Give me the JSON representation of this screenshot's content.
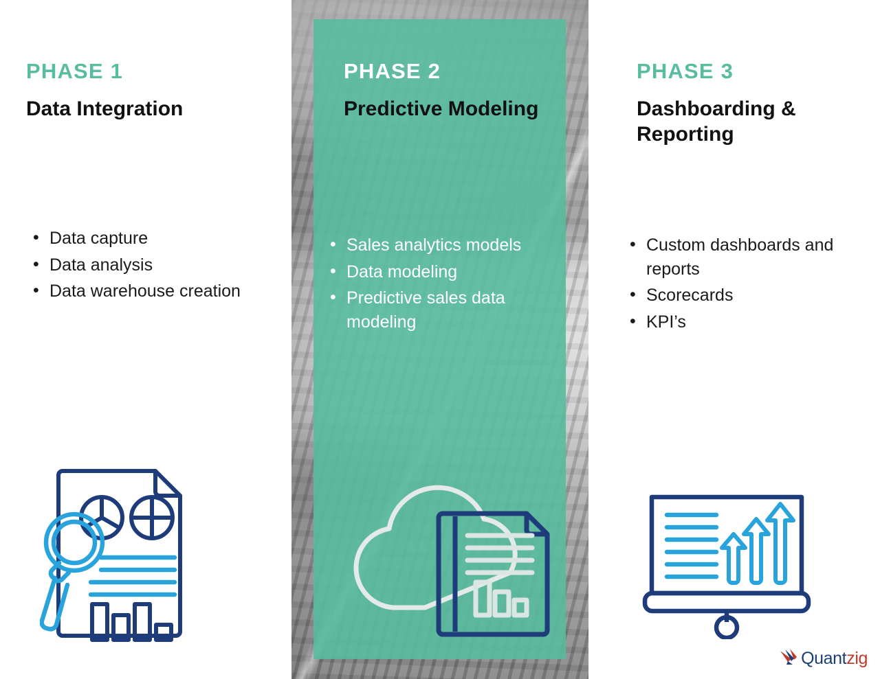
{
  "theme": {
    "teal": "#57bb9e",
    "teal_text": "#58bd9f",
    "navy": "#1f3c7a",
    "light_blue": "#29a3dc",
    "white": "#ffffff",
    "black": "#111111",
    "logo_navy": "#1d3f76",
    "logo_red": "#c0392b"
  },
  "columns": [
    {
      "phase_label": "PHASE 1",
      "title": "Data Integration",
      "bullets": [
        "Data capture",
        "Data analysis",
        "Data warehouse creation"
      ],
      "icon": "document-analysis-icon"
    },
    {
      "phase_label": "PHASE 2",
      "title": "Predictive Modeling",
      "bullets": [
        "Sales analytics models",
        "Data modeling",
        "Predictive sales data modeling"
      ],
      "icon": "cloud-document-icon"
    },
    {
      "phase_label": "PHASE 3",
      "title": "Dashboarding & Reporting",
      "bullets": [
        "Custom dashboards and reports",
        "Scorecards",
        "KPI’s"
      ],
      "icon": "presentation-chart-icon"
    }
  ],
  "logo": {
    "part_1": "Quant",
    "part_2": "zig",
    "mark": "quantzig-arrow-mark"
  }
}
